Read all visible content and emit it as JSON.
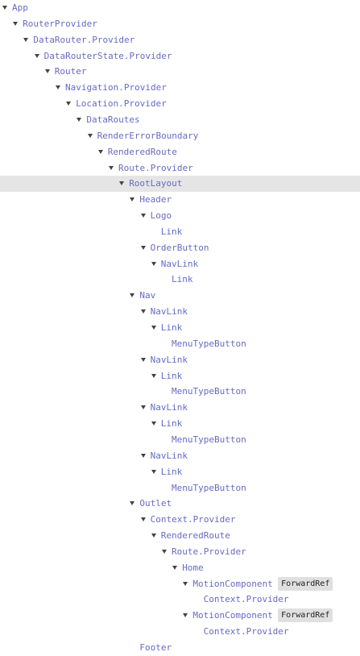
{
  "colors": {
    "component": "#6969c8",
    "selected_row": "#e5e5e5",
    "badge_bg": "#e0e0e0",
    "arrow": "#444444"
  },
  "tree": [
    {
      "name": "App",
      "depth": 0,
      "expanded": true
    },
    {
      "name": "RouterProvider",
      "depth": 1,
      "expanded": true
    },
    {
      "name": "DataRouter.Provider",
      "depth": 2,
      "expanded": true
    },
    {
      "name": "DataRouterState.Provider",
      "depth": 3,
      "expanded": true
    },
    {
      "name": "Router",
      "depth": 4,
      "expanded": true
    },
    {
      "name": "Navigation.Provider",
      "depth": 5,
      "expanded": true
    },
    {
      "name": "Location.Provider",
      "depth": 6,
      "expanded": true
    },
    {
      "name": "DataRoutes",
      "depth": 7,
      "expanded": true
    },
    {
      "name": "RenderErrorBoundary",
      "depth": 8,
      "expanded": true
    },
    {
      "name": "RenderedRoute",
      "depth": 9,
      "expanded": true
    },
    {
      "name": "Route.Provider",
      "depth": 10,
      "expanded": true
    },
    {
      "name": "RootLayout",
      "depth": 11,
      "expanded": true,
      "selected": true
    },
    {
      "name": "Header",
      "depth": 12,
      "expanded": true
    },
    {
      "name": "Logo",
      "depth": 13,
      "expanded": true
    },
    {
      "name": "Link",
      "depth": 14,
      "expanded": false
    },
    {
      "name": "OrderButton",
      "depth": 13,
      "expanded": true
    },
    {
      "name": "NavLink",
      "depth": 14,
      "expanded": true
    },
    {
      "name": "Link",
      "depth": 15,
      "expanded": false
    },
    {
      "name": "Nav",
      "depth": 12,
      "expanded": true
    },
    {
      "name": "NavLink",
      "depth": 13,
      "expanded": true
    },
    {
      "name": "Link",
      "depth": 14,
      "expanded": true
    },
    {
      "name": "MenuTypeButton",
      "depth": 15,
      "expanded": false
    },
    {
      "name": "NavLink",
      "depth": 13,
      "expanded": true
    },
    {
      "name": "Link",
      "depth": 14,
      "expanded": true
    },
    {
      "name": "MenuTypeButton",
      "depth": 15,
      "expanded": false
    },
    {
      "name": "NavLink",
      "depth": 13,
      "expanded": true
    },
    {
      "name": "Link",
      "depth": 14,
      "expanded": true
    },
    {
      "name": "MenuTypeButton",
      "depth": 15,
      "expanded": false
    },
    {
      "name": "NavLink",
      "depth": 13,
      "expanded": true
    },
    {
      "name": "Link",
      "depth": 14,
      "expanded": true
    },
    {
      "name": "MenuTypeButton",
      "depth": 15,
      "expanded": false
    },
    {
      "name": "Outlet",
      "depth": 12,
      "expanded": true
    },
    {
      "name": "Context.Provider",
      "depth": 13,
      "expanded": true
    },
    {
      "name": "RenderedRoute",
      "depth": 14,
      "expanded": true
    },
    {
      "name": "Route.Provider",
      "depth": 15,
      "expanded": true
    },
    {
      "name": "Home",
      "depth": 16,
      "expanded": true
    },
    {
      "name": "MotionComponent",
      "depth": 17,
      "expanded": true,
      "badge": "ForwardRef"
    },
    {
      "name": "Context.Provider",
      "depth": 18,
      "expanded": false
    },
    {
      "name": "MotionComponent",
      "depth": 17,
      "expanded": true,
      "badge": "ForwardRef"
    },
    {
      "name": "Context.Provider",
      "depth": 18,
      "expanded": false
    },
    {
      "name": "Footer",
      "depth": 12,
      "expanded": false
    }
  ]
}
